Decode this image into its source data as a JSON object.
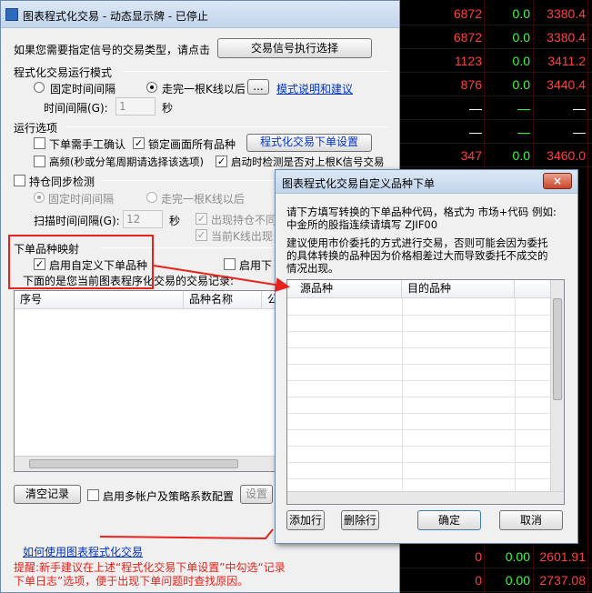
{
  "quotes": [
    {
      "c1": "6872",
      "c2": "0.0",
      "c3": "3380.4",
      "color": "#ff4040"
    },
    {
      "c1": "6872",
      "c2": "0.0",
      "c3": "3380.4",
      "color": "#ff4040"
    },
    {
      "c1": "1123",
      "c2": "0.0",
      "c3": "3411.2",
      "color": "#ff4040"
    },
    {
      "c1": "876",
      "c2": "0.0",
      "c3": "3440.4",
      "color": "#ff4040"
    },
    {
      "c1": "—",
      "c2": "—",
      "c3": "—",
      "color": "#ffffff"
    },
    {
      "c1": "—",
      "c2": "—",
      "c3": "—",
      "color": "#ffffff"
    },
    {
      "c1": "347",
      "c2": "0.0",
      "c3": "3460.0",
      "color": "#ff4040"
    }
  ],
  "quotes_bottom": [
    {
      "c1": "0",
      "c2": "0.00",
      "c3": "2601.91",
      "color": "#ff4040"
    },
    {
      "c1": "0",
      "c2": "0.00",
      "c3": "2737.08",
      "color": "#ff4040"
    }
  ],
  "main": {
    "title": "图表程式化交易 - 动态显示牌 - 已停止",
    "intro": "如果您需要指定信号的交易类型，请点击",
    "signal_button": "交易信号执行选择",
    "mode_group": "程式化交易运行模式",
    "radio_fixed": "固定时间间隔",
    "radio_kline": "走完一根K线以后",
    "dots_button": "...",
    "mode_link": "模式说明和建议",
    "interval_label": "时间间隔(G):",
    "interval_value": "1",
    "seconds": "秒",
    "options_group": "运行选项",
    "cb_manual": "下单需手工确认",
    "cb_lock": "锁定画面所有品种",
    "order_settings_button": "程式化交易下单设置",
    "cb_highfreq": "高频(秒或分笔周期请选择该选项)",
    "cb_check_upper": "启动时检测是否对上根K信号交易",
    "cb_sync": "持仓同步检测",
    "sync_fixed": "固定时间间隔",
    "sync_kline": "走完一根K线以后",
    "scan_label": "扫描时间间隔(G):",
    "scan_value": "12",
    "scan_seconds": "秒",
    "cb_hold_no": "出现持仓不同",
    "cb_current_k": "当前K线出现",
    "mapping_group": "下单品种映射",
    "cb_custom_symbol": "启用自定义下单品种",
    "cb_enable_right": "启用下",
    "list_desc": "下面的是您当前图表程序化交易的交易记录:",
    "col_seq": "序号",
    "col_name": "品种名称",
    "col_extra": "公",
    "clear_button": "清空记录",
    "cb_multi": "启用多帐户及策略系数配置",
    "setup_button": "设置",
    "help_link": "如何使用图表程式化交易",
    "tip_line1": "提醒:新手建议在上述“程式化交易下单设置”中勾选“记录",
    "tip_line2": "下单日志”选项，便于出现下单问题时查找原因。"
  },
  "dialog": {
    "title": "图表程式化交易自定义品种下单",
    "close": "×",
    "desc_line1": "请下方填写转换的下单品种代码，格式为 市场+代码 例如:",
    "desc_line2": "中金所的股指连续请填写 ZJIF00",
    "warn_line1": "建议使用市价委托的方式进行交易，否则可能会因为委托",
    "warn_line2": "的具体转换的品种因为价格相差过大而导致委托不成交的",
    "warn_line3": "情况出现。",
    "col_source": "源品种",
    "col_target": "目的品种",
    "add_button": "添加行",
    "delete_button": "删除行",
    "ok_button": "确定",
    "cancel_button": "取消"
  },
  "colors": {
    "annotation": "#e8221a",
    "link": "#0033cc",
    "tip": "#e8221a"
  }
}
